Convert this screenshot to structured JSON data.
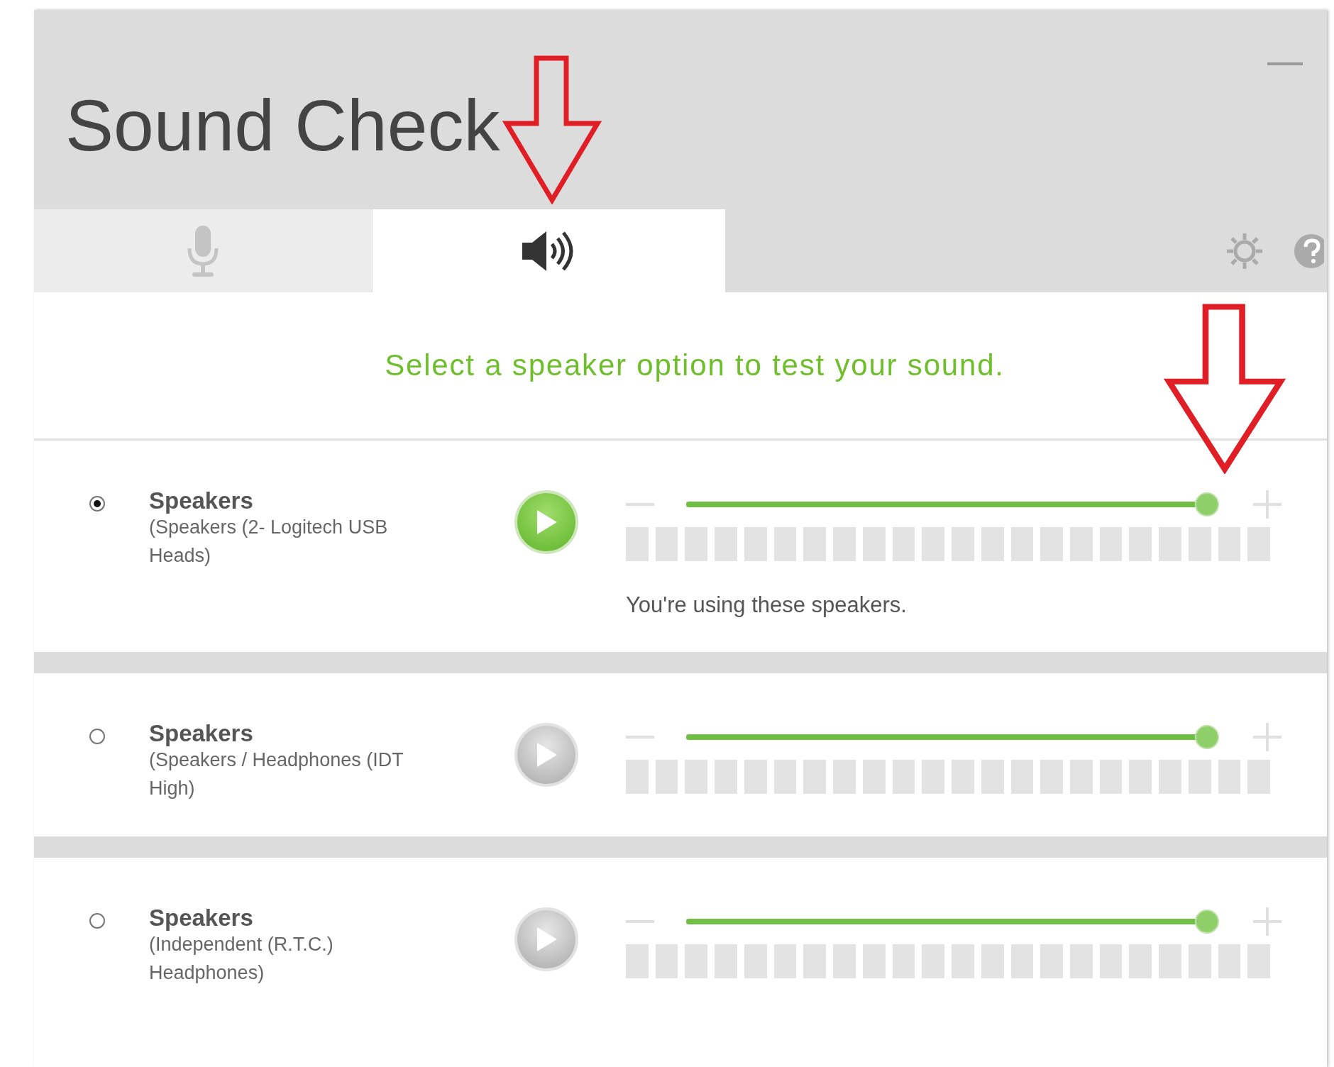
{
  "window": {
    "title": "Sound Check"
  },
  "tabs": [
    {
      "kind": "microphone",
      "selected": false
    },
    {
      "kind": "speaker",
      "selected": true
    }
  ],
  "instruction": "Select a speaker option to test your sound.",
  "devices": [
    {
      "name": "Speakers",
      "detail": "(Speakers (2- Logitech USB Heads)",
      "selected": true,
      "level": 0.98,
      "status": "You're using these speakers."
    },
    {
      "name": "Speakers",
      "detail": "(Speakers / Headphones (IDT High)",
      "selected": false,
      "level": 0.98
    },
    {
      "name": "Speakers",
      "detail": "(Independent (R.T.C.) Headphones)",
      "selected": false,
      "level": 0.98
    }
  ]
}
